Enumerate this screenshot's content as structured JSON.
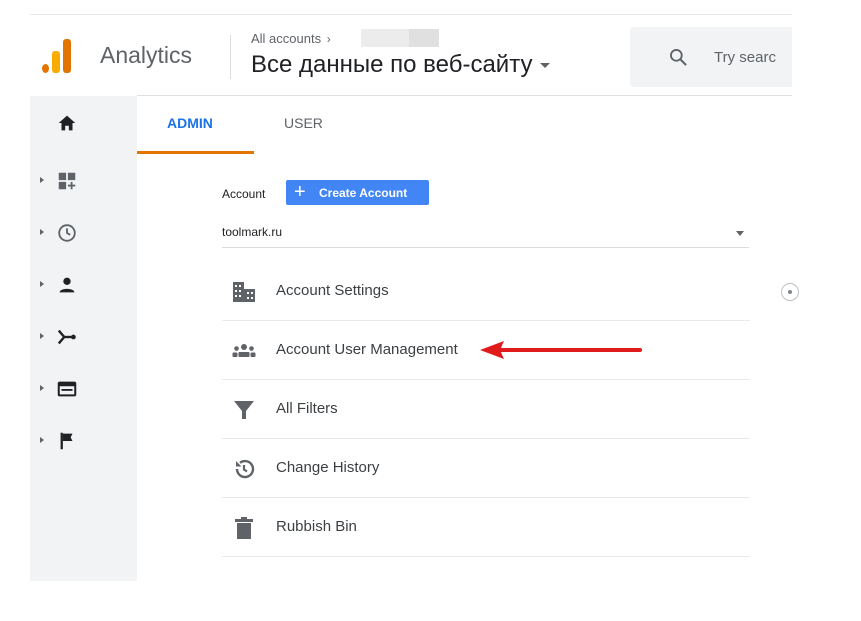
{
  "header": {
    "app_name": "Analytics",
    "breadcrumb": "All accounts",
    "breadcrumb_chevron": "›",
    "property_name": "Все данные по веб-сайту",
    "search_placeholder": "Try searc"
  },
  "tabs": [
    {
      "label": "ADMIN",
      "active": true
    },
    {
      "label": "USER",
      "active": false
    }
  ],
  "sidebar": {
    "items": [
      {
        "icon": "home-icon"
      },
      {
        "icon": "customization-icon"
      },
      {
        "icon": "realtime-clock-icon"
      },
      {
        "icon": "audience-person-icon"
      },
      {
        "icon": "acquisition-icon"
      },
      {
        "icon": "behavior-icon"
      },
      {
        "icon": "conversions-flag-icon"
      }
    ]
  },
  "account": {
    "label": "Account",
    "create_button": "Create Account",
    "create_button_plus": "+",
    "selected": "toolmark.ru"
  },
  "menu": [
    {
      "label": "Account Settings",
      "icon": "building-icon"
    },
    {
      "label": "Account User Management",
      "icon": "people-icon"
    },
    {
      "label": "All Filters",
      "icon": "filter-icon"
    },
    {
      "label": "Change History",
      "icon": "history-icon"
    },
    {
      "label": "Rubbish Bin",
      "icon": "trash-icon"
    }
  ],
  "colors": {
    "accent_blue": "#1a73e8",
    "tab_underline": "#e37400",
    "button_blue": "#4285f4",
    "annotation_arrow": "#e01b1b"
  }
}
